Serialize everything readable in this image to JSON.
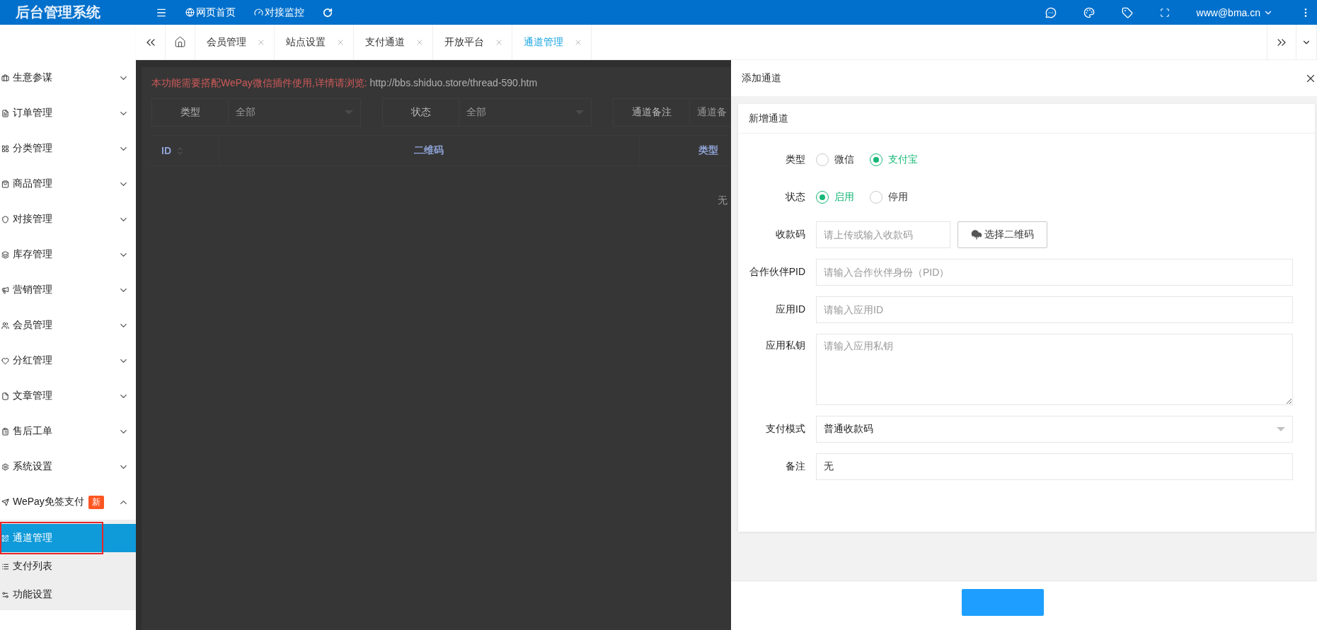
{
  "header": {
    "title": "后台管理系统",
    "nav": [
      {
        "label": "网页首页"
      },
      {
        "label": "对接监控"
      }
    ],
    "user": "www@bma.cn"
  },
  "sidebar": {
    "items": [
      {
        "label": "生意参谋",
        "expanded": false
      },
      {
        "label": "订单管理",
        "expanded": false
      },
      {
        "label": "分类管理",
        "expanded": false
      },
      {
        "label": "商品管理",
        "expanded": false
      },
      {
        "label": "对接管理",
        "expanded": false
      },
      {
        "label": "库存管理",
        "expanded": false
      },
      {
        "label": "营销管理",
        "expanded": false
      },
      {
        "label": "会员管理",
        "expanded": false
      },
      {
        "label": "分红管理",
        "expanded": false
      },
      {
        "label": "文章管理",
        "expanded": false
      },
      {
        "label": "售后工单",
        "expanded": false
      },
      {
        "label": "系统设置",
        "expanded": false
      },
      {
        "label": "WePay免签支付",
        "badge": "新",
        "expanded": true,
        "children": [
          {
            "label": "通道管理",
            "selected": true
          },
          {
            "label": "支付列表",
            "selected": false
          },
          {
            "label": "功能设置",
            "selected": false
          }
        ]
      }
    ]
  },
  "tabs": [
    {
      "label": "会员管理",
      "selected": false
    },
    {
      "label": "站点设置",
      "selected": false
    },
    {
      "label": "支付通道",
      "selected": false
    },
    {
      "label": "开放平台",
      "selected": false
    },
    {
      "label": "通道管理",
      "selected": true
    }
  ],
  "page": {
    "notice": "本功能需要搭配WePay微信插件使用,详情请浏览:",
    "notice_link": "http://bbs.shiduo.store/thread-590.htm",
    "filters": [
      {
        "label": "类型",
        "kind": "select",
        "placeholder": "全部"
      },
      {
        "label": "状态",
        "kind": "select",
        "placeholder": "全部"
      },
      {
        "label": "通道备注",
        "kind": "input",
        "placeholder": "通道备"
      }
    ],
    "table": {
      "columns": [
        {
          "label": "ID",
          "sortable": true
        },
        {
          "label": "二维码",
          "sortable": false
        },
        {
          "label": "类型",
          "sortable": false
        }
      ],
      "empty_text": "无"
    }
  },
  "drawer": {
    "title": "添加通道",
    "card_title": "新增通道",
    "fields": [
      {
        "kind": "radio",
        "label": "类型",
        "options": [
          {
            "label": "微信",
            "selected": false
          },
          {
            "label": "支付宝",
            "selected": true
          }
        ]
      },
      {
        "kind": "radio",
        "label": "状态",
        "options": [
          {
            "label": "启用",
            "selected": true
          },
          {
            "label": "停用",
            "selected": false
          }
        ]
      },
      {
        "kind": "upload",
        "label": "收款码",
        "placeholder": "请上传或输入收款码",
        "button": "选择二维码"
      },
      {
        "kind": "input",
        "label": "合作伙伴PID",
        "placeholder": "请输入合作伙伴身份（PID）"
      },
      {
        "kind": "input",
        "label": "应用ID",
        "placeholder": "请输入应用ID"
      },
      {
        "kind": "textarea",
        "label": "应用私钥",
        "placeholder": "请输入应用私钥"
      },
      {
        "kind": "select",
        "label": "支付模式",
        "value": "普通收款码"
      },
      {
        "kind": "input",
        "label": "备注",
        "value": "无"
      }
    ]
  }
}
